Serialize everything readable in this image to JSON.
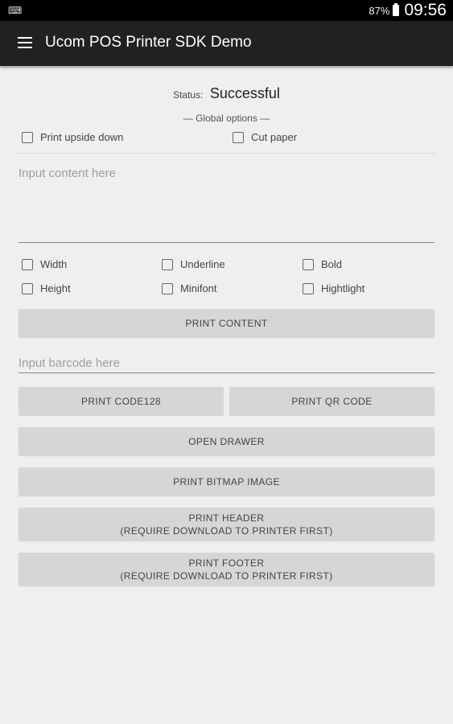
{
  "statusbar": {
    "battery": "87%",
    "time": "09:56",
    "notification_icon": "keyboard-icon"
  },
  "appbar": {
    "title": "Ucom POS Printer SDK Demo",
    "menu_icon": "hamburger-menu-icon"
  },
  "status": {
    "label": "Status:",
    "value": "Successful"
  },
  "global_options": {
    "heading": "— Global options —",
    "upside_down": "Print upside down",
    "cut_paper": "Cut paper"
  },
  "content_input": {
    "placeholder": "Input content here",
    "value": ""
  },
  "format_options": {
    "width": "Width",
    "underline": "Underline",
    "bold": "Bold",
    "height": "Height",
    "minifont": "Minifont",
    "highlight": "Hightlight"
  },
  "buttons": {
    "print_content": "PRINT CONTENT",
    "print_code128": "PRINT CODE128",
    "print_qr": "PRINT QR CODE",
    "open_drawer": "OPEN DRAWER",
    "print_bitmap": "PRINT BITMAP IMAGE",
    "print_header_line1": "PRINT HEADER",
    "print_header_line2": "(REQUIRE DOWNLOAD TO PRINTER FIRST)",
    "print_footer_line1": "PRINT FOOTER",
    "print_footer_line2": "(REQUIRE DOWNLOAD TO PRINTER FIRST)"
  },
  "barcode_input": {
    "placeholder": "Input barcode here",
    "value": ""
  }
}
